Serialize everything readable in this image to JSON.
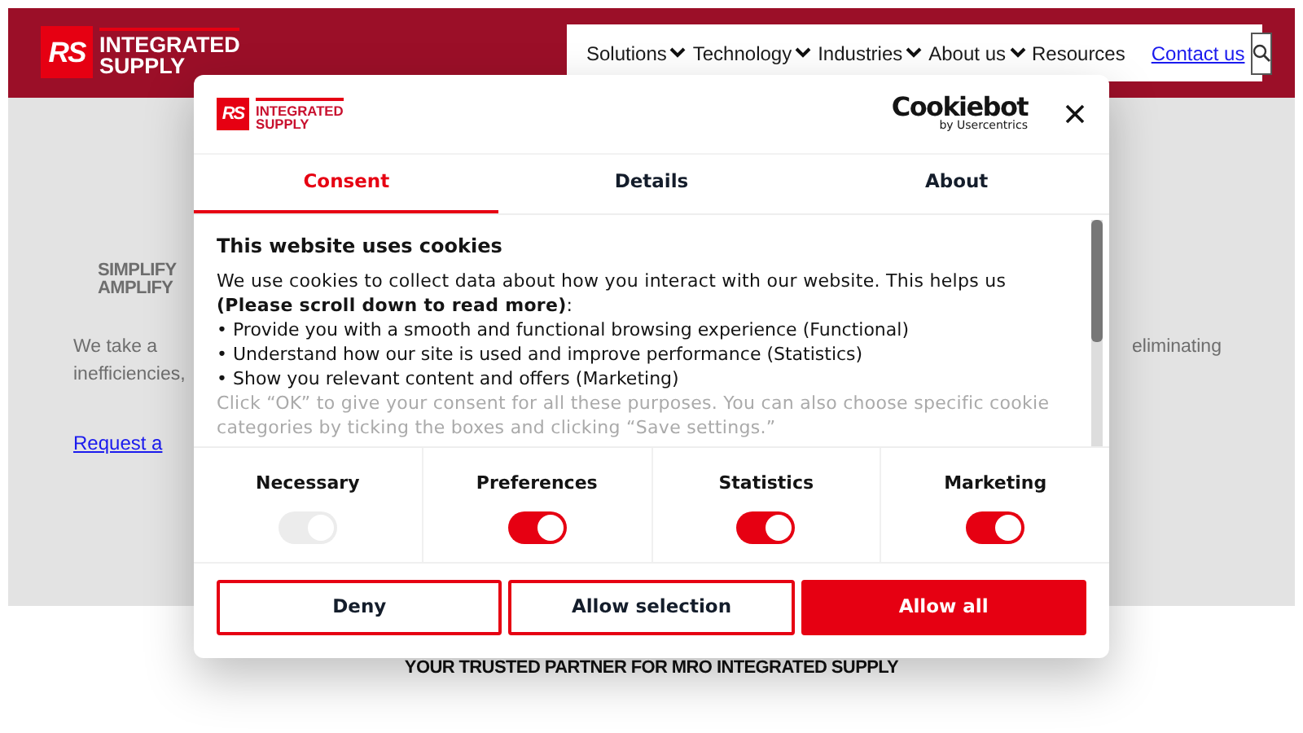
{
  "header": {
    "logo": {
      "mark": "RS",
      "line1": "INTEGRATED",
      "line2": "SUPPLY"
    },
    "nav": [
      {
        "label": "Solutions",
        "has_menu": true
      },
      {
        "label": "Technology",
        "has_menu": true
      },
      {
        "label": "Industries",
        "has_menu": true
      },
      {
        "label": "About us",
        "has_menu": true
      },
      {
        "label": "Resources",
        "has_menu": false
      }
    ],
    "contact_link": "Contact us"
  },
  "hero": {
    "heading_lines": [
      "SIMPLIFY",
      "AMPLIFY"
    ],
    "paragraph_lines": [
      "We take a",
      "inefficiencies,"
    ],
    "right_fragment": "eliminating",
    "link": "Request a"
  },
  "tagline": "YOUR TRUSTED PARTNER FOR MRO INTEGRATED SUPPLY",
  "dialog": {
    "logo": {
      "mark": "RS",
      "line1": "INTEGRATED",
      "line2": "SUPPLY"
    },
    "brand": {
      "name": "Cookiebot",
      "sub": "by Usercentrics"
    },
    "tabs": [
      {
        "label": "Consent",
        "selected": true
      },
      {
        "label": "Details",
        "selected": false
      },
      {
        "label": "About",
        "selected": false
      }
    ],
    "title": "This website uses cookies",
    "intro": "We use cookies to collect data about how you interact with our website. This helps us **(Please scroll down to read more)**:",
    "bullets": [
      "• Provide you with a smooth and functional browsing experience (Functional)",
      "• Understand how our site is used and improve performance (Statistics)",
      "• Show you relevant content and offers (Marketing)"
    ],
    "faded": "Click “OK” to give your consent for all these purposes. You can also choose specific cookie categories by ticking the boxes and clicking “Save settings.”",
    "categories": [
      {
        "label": "Necessary",
        "on": true,
        "disabled": true
      },
      {
        "label": "Preferences",
        "on": true,
        "disabled": false
      },
      {
        "label": "Statistics",
        "on": true,
        "disabled": false
      },
      {
        "label": "Marketing",
        "on": true,
        "disabled": false
      }
    ],
    "buttons": [
      {
        "label": "Deny",
        "kind": "outline"
      },
      {
        "label": "Allow selection",
        "kind": "outline"
      },
      {
        "label": "Allow all",
        "kind": "solid"
      }
    ]
  }
}
